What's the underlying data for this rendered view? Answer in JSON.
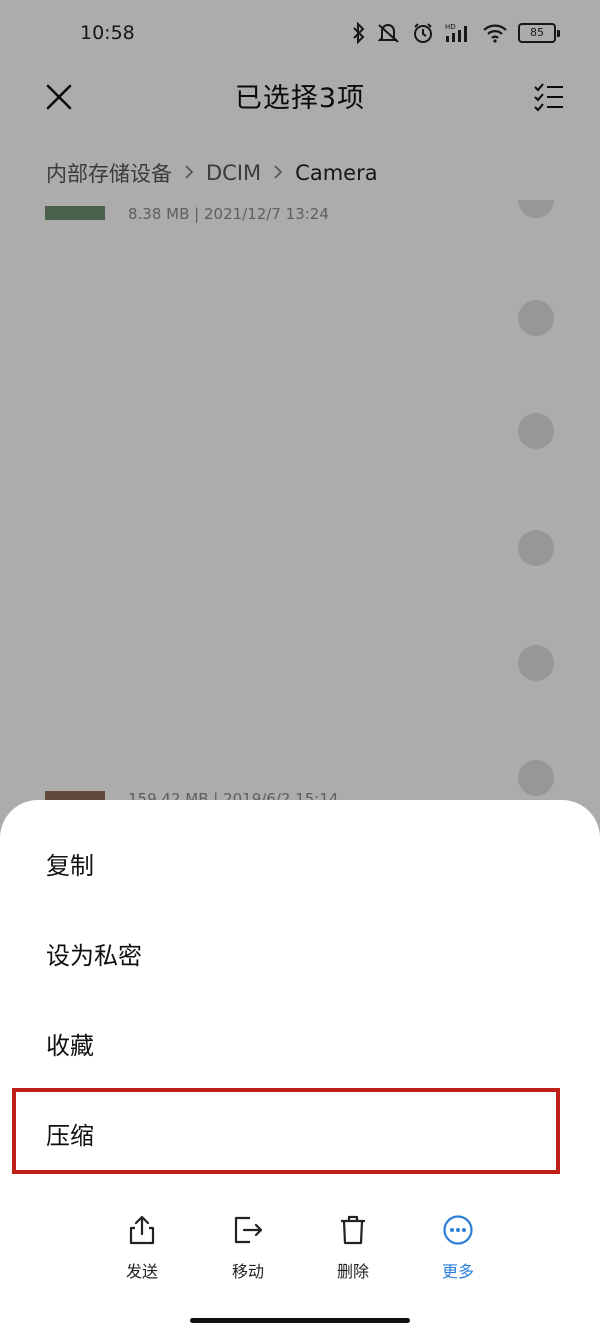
{
  "status_bar": {
    "time": "10:58",
    "battery": "85"
  },
  "header": {
    "title": "已选择3项"
  },
  "breadcrumb": {
    "items": [
      "内部存储设备",
      "DCIM",
      "Camera"
    ]
  },
  "files": [
    {
      "meta": "8.38 MB  |  2021/12/7 13:24"
    },
    {
      "meta": "159.42 MB  |  2019/6/2 15:14"
    }
  ],
  "sheet": {
    "items": [
      {
        "label": "复制"
      },
      {
        "label": "设为私密"
      },
      {
        "label": "收藏"
      },
      {
        "label": "压缩"
      }
    ]
  },
  "toolbar": {
    "items": [
      {
        "label": "发送",
        "icon": "share-icon"
      },
      {
        "label": "移动",
        "icon": "move-icon"
      },
      {
        "label": "删除",
        "icon": "trash-icon"
      },
      {
        "label": "更多",
        "icon": "more-icon"
      }
    ],
    "active_color": "#2b7fd9"
  },
  "highlight_color": "#c0201a"
}
